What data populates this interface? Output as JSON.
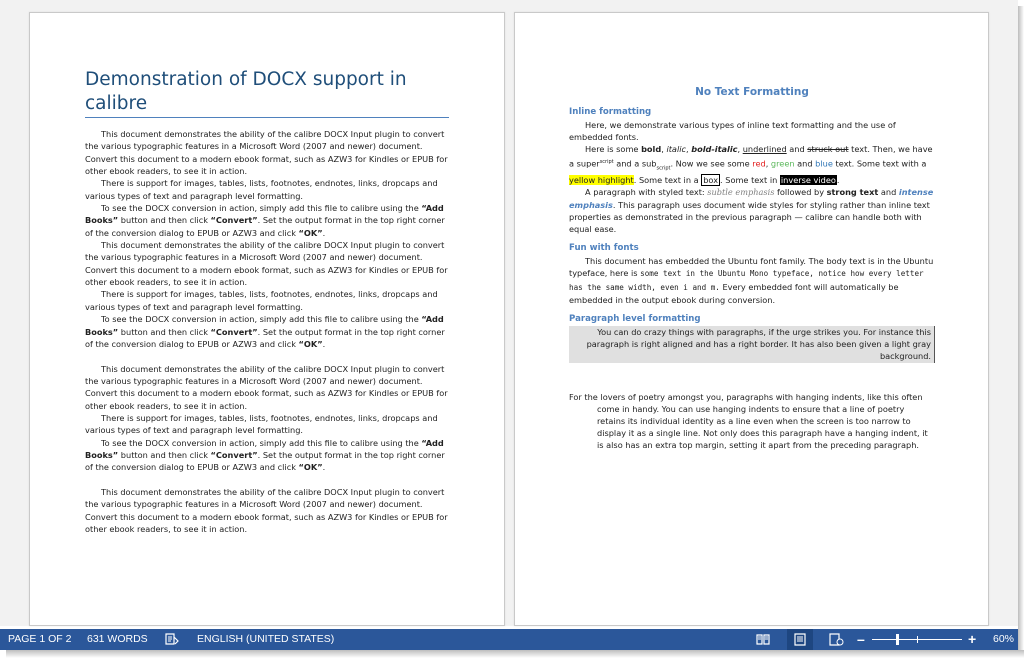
{
  "page1": {
    "title": "Demonstration of DOCX support in calibre",
    "intro": "This document demonstrates the ability of the calibre DOCX Input plugin to convert the various typographic features in a Microsoft Word (2007 and newer) document. Convert this document to a modern ebook format, such as AZW3 for Kindles or EPUB for other ebook readers, to see it in action.",
    "support": "There is support for images, tables, lists, footnotes, endnotes, links, dropcaps and various types of text and paragraph level formatting.",
    "see_pre": "To see the DOCX conversion in action, simply add this file to calibre using the ",
    "add_books": "“Add Books”",
    "see_mid": " button and then click ",
    "convert": "“Convert”",
    "see_mid2": ".  Set the output format in the top right corner of the conversion dialog to EPUB or AZW3 and click ",
    "ok": "“OK”",
    "see_end": "."
  },
  "page2": {
    "heading": "No Text Formatting",
    "inline_heading": "Inline formatting",
    "inline_p1": "Here, we demonstrate various types of inline text formatting and the use of embedded fonts.",
    "ex": {
      "t1": "Here is some ",
      "bold": "bold",
      "c1": ", ",
      "italic": "italic",
      "c2": ", ",
      "bolditalic": "bold-italic",
      "c3": ", ",
      "underlined": "underlined",
      "c4": " and ",
      "struck": "struck out",
      "t2": " text. Then, we have a super",
      "sup": "script",
      "t3": " and a sub",
      "sub": "script",
      "t4": ". Now we see some ",
      "red": "red",
      "c5": ", ",
      "green": "green",
      "c6": " and ",
      "blue": "blue",
      "t5": " text. Some text with a ",
      "yellow": "yellow highlight",
      "t6": ". Some text in a ",
      "box": "box",
      "t7": ". Some text in ",
      "inverse": "inverse video",
      "t8": "."
    },
    "styled": {
      "t1": "A paragraph with styled text: ",
      "subtle": "subtle emphasis",
      "t2": " followed by ",
      "strong": "strong text",
      "t3": " and ",
      "intense": "intense emphasis",
      "t4": ". This paragraph uses document wide styles for styling rather than inline text properties as demonstrated in the previous paragraph — calibre can handle both with equal ease."
    },
    "fonts_heading": "Fun with fonts",
    "fonts": {
      "t1": "This document has embedded the Ubuntu font family. The body text is in the Ubuntu typeface, here is ",
      "mono": "some text in the Ubuntu Mono typeface, notice how every letter has the same width, even i and m.",
      "t2": " Every embedded font will automatically be embedded in the output ebook during conversion."
    },
    "para_heading": "Paragraph level formatting",
    "para_box": "You can do crazy things with paragraphs, if the urge strikes you. For instance this paragraph is right aligned and has a right border. It has also been given a light gray background.",
    "poetry": "For the lovers of poetry amongst you, paragraphs with hanging indents, like this often come in handy. You can use hanging indents to ensure that a line of poetry retains its individual identity as a line even when the screen is  too narrow to display it as a single line. Not only does this paragraph have a hanging indent, it is also has an extra top margin, setting it apart from the preceding paragraph."
  },
  "statusbar": {
    "page": "PAGE 1 OF 2",
    "words": "631 WORDS",
    "language": "ENGLISH (UNITED STATES)",
    "zoom": "60%",
    "zoom_level": 0.6,
    "colors": {
      "bar": "#2b579a",
      "text": "#ffffff"
    },
    "icons": [
      "proofing-icon",
      "read-mode-icon",
      "print-layout-icon",
      "web-layout-icon",
      "zoom-out-icon",
      "zoom-in-icon"
    ]
  }
}
